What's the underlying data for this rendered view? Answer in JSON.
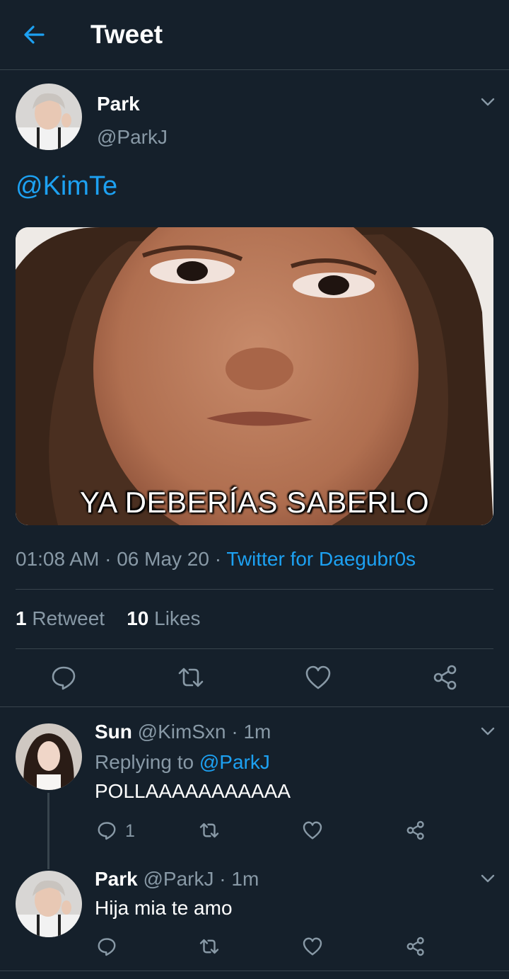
{
  "header": {
    "title": "Tweet",
    "back_icon": "arrow-left-icon"
  },
  "colors": {
    "background": "#15202b",
    "accent": "#1da1f2",
    "muted": "#8899a6",
    "divider": "#38444d"
  },
  "tweet": {
    "name": "Park",
    "handle": "@ParkJ",
    "text": "@KimTe",
    "image_caption": "YA DEBERÍAS SABERLO",
    "time": "01:08 AM",
    "date": "06 May 20",
    "dot": "·",
    "source": "Twitter for Daegubr0s",
    "retweet_count": "1",
    "retweet_label": "Retweet",
    "like_count": "10",
    "like_label": "Likes"
  },
  "replies": [
    {
      "name": "Sun",
      "handle": "@KimSxn",
      "time": "· 1m",
      "replying_prefix": "Replying to",
      "replying_to": "@ParkJ",
      "text": "POLLAAAAAAAAAAA",
      "reply_count": "1"
    },
    {
      "name": "Park",
      "handle": "@ParkJ",
      "time": "· 1m",
      "text": "Hija mia te amo"
    }
  ]
}
